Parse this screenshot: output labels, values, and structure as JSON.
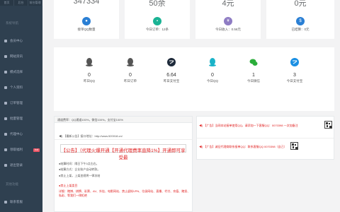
{
  "sidebar": {
    "top_buttons": [
      "首页",
      "后台",
      "前台管理"
    ],
    "section_main": "系统导航",
    "items": [
      {
        "label": "会员中心",
        "icon": "user-icon"
      },
      {
        "label": "网站资讯",
        "icon": "news-icon"
      },
      {
        "label": "模式选择",
        "icon": "mode-icon"
      },
      {
        "label": "个人资料",
        "icon": "profile-icon"
      },
      {
        "label": "订单管理",
        "icon": "order-icon"
      },
      {
        "label": "批量管理",
        "icon": "batch-icon"
      },
      {
        "label": "代理中心",
        "icon": "agent-icon"
      },
      {
        "label": "领取福利",
        "icon": "gift-icon",
        "badge": "hot"
      },
      {
        "label": "退出登录",
        "icon": "logout-icon"
      }
    ],
    "section_other": "其他功能",
    "bottom_item": {
      "label": "联系客服",
      "icon": "service-icon"
    }
  },
  "top_cards": [
    {
      "value": "347334",
      "label": "接单QQ数量",
      "icon": "user-icon",
      "color": "#2a7fd4"
    },
    {
      "value": "50余",
      "label": "今日订单：12条",
      "icon": "cart-icon",
      "color": "#1ab394"
    },
    {
      "value": "4元",
      "label": "今日收入：0.56元",
      "icon": "money-icon",
      "color": "#8e7cc3"
    },
    {
      "value": "0元",
      "label": "已结算：0元",
      "icon": "wallet-icon",
      "color": "#2a7fd4"
    }
  ],
  "stats": [
    {
      "value": "0",
      "label": "昨日QQ",
      "icon": "qq-icon",
      "color": "#555555"
    },
    {
      "value": "0",
      "label": "昨日订单",
      "icon": "qq-icon",
      "color": "#555555"
    },
    {
      "value": "6.64",
      "label": "昨日支付宝",
      "icon": "alipay-icon",
      "color": "#1e2a3a"
    },
    {
      "value": "0",
      "label": "今日QQ",
      "icon": "qq-icon",
      "color": "#1ab3c8"
    },
    {
      "value": "1",
      "label": "今日微信",
      "icon": "wechat-icon",
      "color": "#2bad3a"
    },
    {
      "value": "3",
      "label": "今日支付宝",
      "icon": "alipay-icon",
      "color": "#1a8fe3"
    }
  ],
  "announcement": {
    "header": "通道费率：QQ通道100%，微信100%，支付宝100%",
    "url_line": "【最新公告】接口地址：http://www.520018.cn/",
    "red_title": "【公告】（代理火爆开通【开通代理费率直降1%】开通即可享受最",
    "lines": [
      "●结算时间：隔日下午3点左右。",
      "●结算方式：企业账户自动转款。",
      "●禁止上架，上架违规将一律冻结"
    ],
    "tag": "●禁止上架类目",
    "last_line": "详细：赌博、棋牌、彩票、AV、外挂、电影网站、禁止虚拟VPN、垃圾网站、直播、代付、充值、赌投、私彩、等我们一律拒绝"
  },
  "notices": [
    "【广告】当网本站接单使用QQ，请添加一下客服QQ：0070398 一次加备注",
    "【广告】诚征代理商联系接单QQ：联系客服QQ 0070398（自己）"
  ]
}
